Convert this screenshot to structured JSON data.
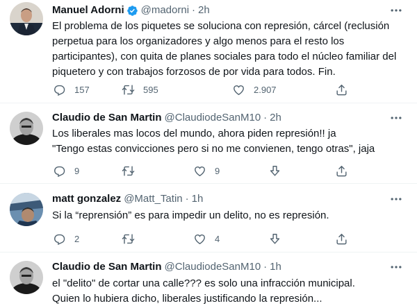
{
  "tweets": [
    {
      "name": "Manuel Adorni",
      "verified": true,
      "handle": "@madorni",
      "time": "2h",
      "text": "El problema de los piquetes se soluciona con represión, cárcel (reclusión\nperpetua para los organizadores y algo menos para el resto los\nparticipantes), con quita de planes sociales para todo el núcleo familiar del\npiquetero y con trabajos forzosos de por vida para todos. Fin.",
      "replies": "157",
      "retweets": "595",
      "likes": "2.907"
    },
    {
      "name": "Claudio de San Martin",
      "verified": false,
      "handle": "@ClaudiodeSanM10",
      "time": "2h",
      "text": "Los liberales mas locos del mundo, ahora piden represión!! ja\n\"Tengo estas convicciones pero si no me convienen, tengo otras\", jaja",
      "replies": "9",
      "retweets": "",
      "likes": "9"
    },
    {
      "name": "matt gonzalez",
      "verified": false,
      "handle": "@Matt_Tatin",
      "time": "1h",
      "text": "Si la “reprensión” es para impedir un delito, no es represión.",
      "replies": "2",
      "retweets": "",
      "likes": "4"
    },
    {
      "name": "Claudio de San Martin",
      "verified": false,
      "handle": "@ClaudiodeSanM10",
      "time": "1h",
      "text": "el \"delito\" de cortar una calle??? es solo una infracción municipal.\nQuien lo hubiera dicho, liberales justificando la represión...",
      "replies": "",
      "retweets": "",
      "likes": ""
    }
  ],
  "ui": {
    "dot": "·"
  },
  "colors": {
    "accent": "#1d9bf0",
    "muted": "#536471",
    "text": "#0f1419",
    "divider": "#eff3f4"
  }
}
